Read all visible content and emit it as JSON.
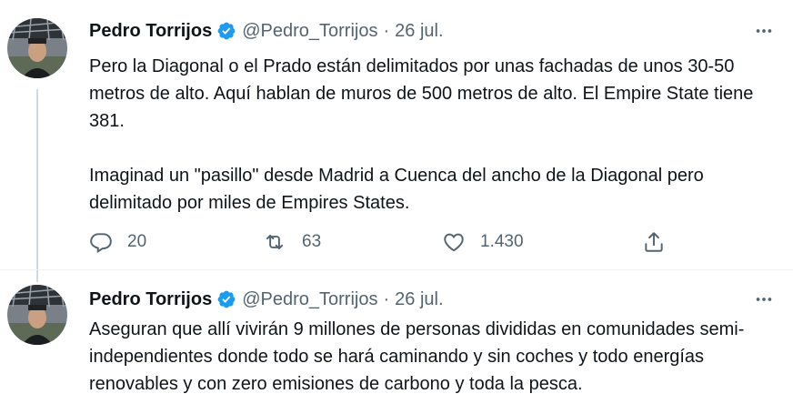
{
  "tweets": [
    {
      "author_name": "Pedro Torrijos",
      "handle": "@Pedro_Torrijos",
      "separator": "·",
      "date": "26 jul.",
      "paragraphs": [
        "Pero la Diagonal o el Prado están delimitados por unas fachadas de unos 30-50 metros de alto. Aquí hablan de muros de 500 metros de alto. El Empire State tiene 381.",
        "Imaginad un \"pasillo\" desde Madrid a Cuenca del ancho de la Diagonal pero delimitado por miles de Empires States."
      ],
      "replies": "20",
      "retweets": "63",
      "likes": "1.430"
    },
    {
      "author_name": "Pedro Torrijos",
      "handle": "@Pedro_Torrijos",
      "separator": "·",
      "date": "26 jul.",
      "paragraphs": [
        "Aseguran que allí vivirán 9 millones de personas divididas en comunidades semi-independientes donde todo se hará caminando y sin coches y todo energías renovables y con zero emisiones de carbono y toda la pesca."
      ]
    }
  ],
  "icons": {
    "verified": "verified-badge-icon",
    "more": "more-options-icon",
    "reply": "reply-icon",
    "retweet": "retweet-icon",
    "like": "like-icon",
    "share": "share-icon"
  },
  "colors": {
    "text": "#0f1419",
    "secondary": "#536471",
    "verified": "#1d9bf0",
    "thread_line": "#cfd9de"
  }
}
